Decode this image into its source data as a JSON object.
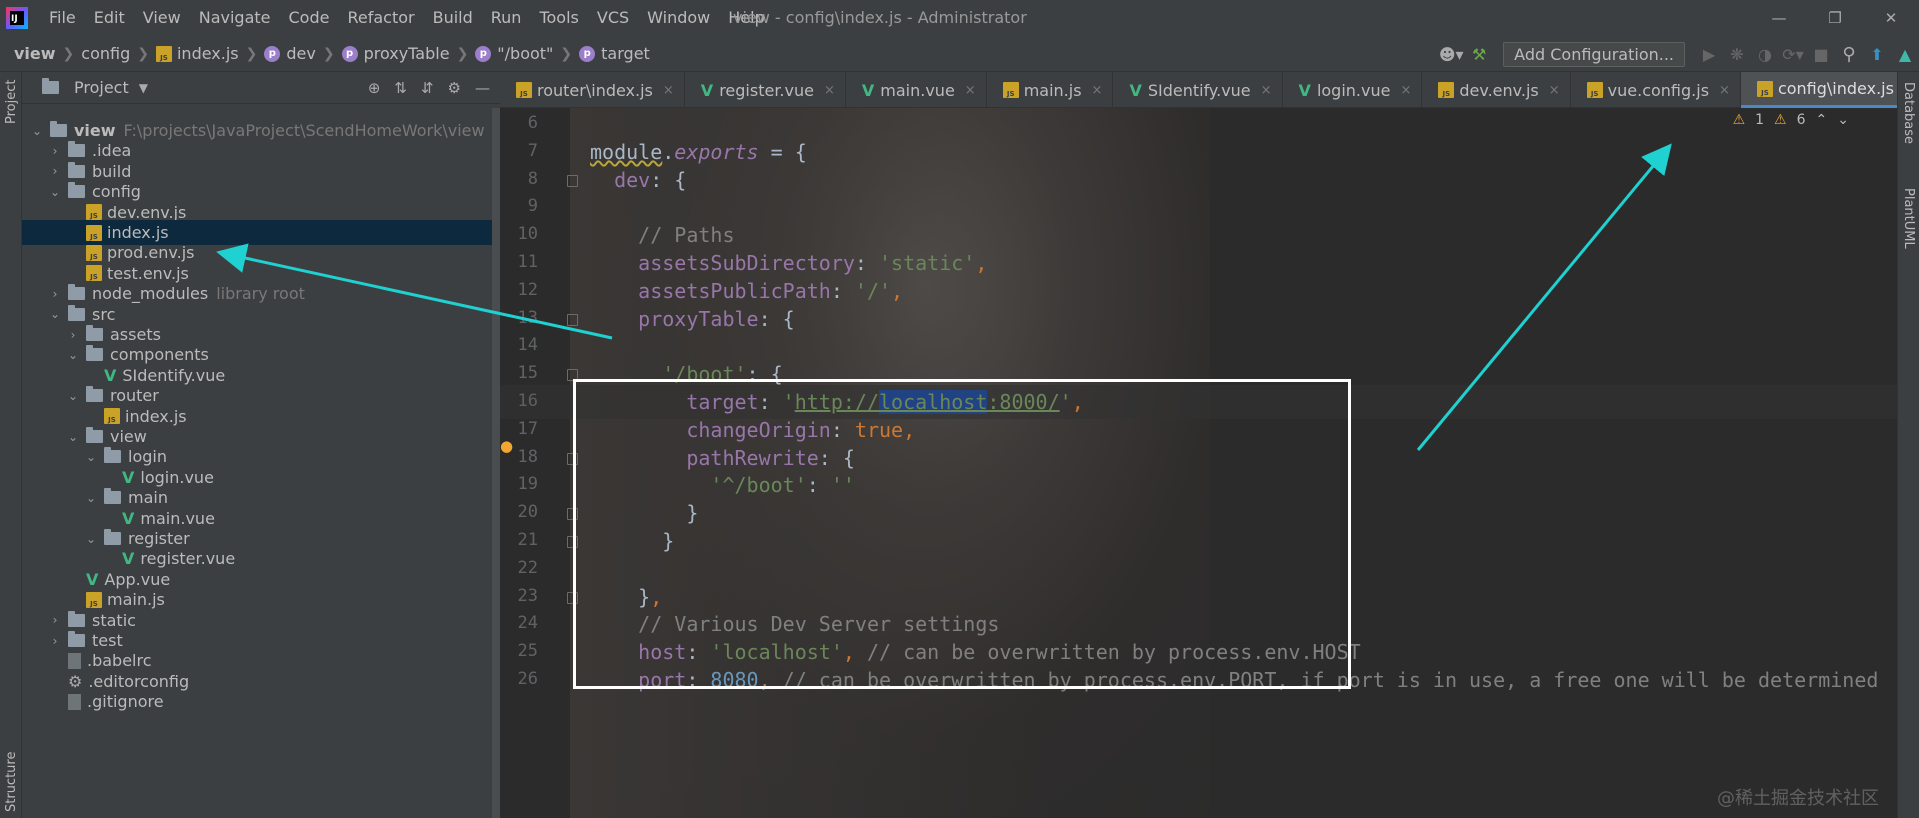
{
  "app": {
    "menu": [
      "File",
      "Edit",
      "View",
      "Navigate",
      "Code",
      "Refactor",
      "Build",
      "Run",
      "Tools",
      "VCS",
      "Window",
      "Help"
    ],
    "window_title": "view - config\\index.js - Administrator"
  },
  "breadcrumb": {
    "project": "view",
    "folder": "config",
    "file": "index.js",
    "prop1": "dev",
    "prop2": "proxyTable",
    "prop3": "\"/boot\"",
    "prop4": "target"
  },
  "toolbar": {
    "add_configuration": "Add Configuration..."
  },
  "project_panel": {
    "title": "Project",
    "strip_label": "Project",
    "structure_label": "Structure",
    "items": [
      {
        "label": "view",
        "hint": "F:\\projects\\JavaProject\\ScendHomeWork\\view",
        "depth": 0,
        "kind": "folder",
        "expanded": true
      },
      {
        "label": ".idea",
        "depth": 1,
        "kind": "folder",
        "expanded": false
      },
      {
        "label": "build",
        "depth": 1,
        "kind": "folder",
        "expanded": false
      },
      {
        "label": "config",
        "depth": 1,
        "kind": "folder",
        "expanded": true
      },
      {
        "label": "dev.env.js",
        "depth": 2,
        "kind": "js"
      },
      {
        "label": "index.js",
        "depth": 2,
        "kind": "js",
        "selected": true
      },
      {
        "label": "prod.env.js",
        "depth": 2,
        "kind": "js"
      },
      {
        "label": "test.env.js",
        "depth": 2,
        "kind": "js"
      },
      {
        "label": "node_modules",
        "hint": "library root",
        "depth": 1,
        "kind": "folder",
        "expanded": false
      },
      {
        "label": "src",
        "depth": 1,
        "kind": "folder",
        "expanded": true
      },
      {
        "label": "assets",
        "depth": 2,
        "kind": "folder",
        "expanded": false
      },
      {
        "label": "components",
        "depth": 2,
        "kind": "folder",
        "expanded": true
      },
      {
        "label": "SIdentify.vue",
        "depth": 3,
        "kind": "vue"
      },
      {
        "label": "router",
        "depth": 2,
        "kind": "folder",
        "expanded": true
      },
      {
        "label": "index.js",
        "depth": 3,
        "kind": "js"
      },
      {
        "label": "view",
        "depth": 2,
        "kind": "folder",
        "expanded": true
      },
      {
        "label": "login",
        "depth": 3,
        "kind": "folder",
        "expanded": true
      },
      {
        "label": "login.vue",
        "depth": 4,
        "kind": "vue"
      },
      {
        "label": "main",
        "depth": 3,
        "kind": "folder",
        "expanded": true
      },
      {
        "label": "main.vue",
        "depth": 4,
        "kind": "vue"
      },
      {
        "label": "register",
        "depth": 3,
        "kind": "folder",
        "expanded": true
      },
      {
        "label": "register.vue",
        "depth": 4,
        "kind": "vue"
      },
      {
        "label": "App.vue",
        "depth": 2,
        "kind": "vue"
      },
      {
        "label": "main.js",
        "depth": 2,
        "kind": "js"
      },
      {
        "label": "static",
        "depth": 1,
        "kind": "folder",
        "expanded": false
      },
      {
        "label": "test",
        "depth": 1,
        "kind": "folder",
        "expanded": false
      },
      {
        "label": ".babelrc",
        "depth": 1,
        "kind": "file"
      },
      {
        "label": ".editorconfig",
        "depth": 1,
        "kind": "gear"
      },
      {
        "label": ".gitignore",
        "depth": 1,
        "kind": "file"
      }
    ]
  },
  "tabs": [
    {
      "label": "router\\index.js",
      "kind": "js"
    },
    {
      "label": "register.vue",
      "kind": "vue"
    },
    {
      "label": "main.vue",
      "kind": "vue"
    },
    {
      "label": "main.js",
      "kind": "js"
    },
    {
      "label": "SIdentify.vue",
      "kind": "vue"
    },
    {
      "label": "login.vue",
      "kind": "vue"
    },
    {
      "label": "dev.env.js",
      "kind": "js"
    },
    {
      "label": "vue.config.js",
      "kind": "js"
    },
    {
      "label": "config\\index.js",
      "kind": "js",
      "active": true
    }
  ],
  "inspections": {
    "warnings": "1",
    "weak_warnings": "6"
  },
  "right_strip": {
    "database": "Database",
    "plantuml": "PlantUML"
  },
  "editor": {
    "current_line": 16,
    "lines": [
      {
        "no": 6,
        "tokens": []
      },
      {
        "no": 7,
        "tokens": [
          {
            "t": "module",
            "c": "squig"
          },
          {
            "t": ".",
            "c": ""
          },
          {
            "t": "exports",
            "c": "ital"
          },
          {
            "t": " = {",
            "c": ""
          }
        ]
      },
      {
        "no": 8,
        "tokens": [
          {
            "t": "  dev",
            "c": "p"
          },
          {
            "t": ": {",
            "c": ""
          }
        ]
      },
      {
        "no": 9,
        "tokens": []
      },
      {
        "no": 10,
        "tokens": [
          {
            "t": "    // Paths",
            "c": "c"
          }
        ]
      },
      {
        "no": 11,
        "tokens": [
          {
            "t": "    assetsSubDirectory",
            "c": "p"
          },
          {
            "t": ": ",
            "c": ""
          },
          {
            "t": "'static'",
            "c": "s"
          },
          {
            "t": ",",
            "c": "k"
          }
        ]
      },
      {
        "no": 12,
        "tokens": [
          {
            "t": "    assetsPublicPath",
            "c": "p"
          },
          {
            "t": ": ",
            "c": ""
          },
          {
            "t": "'/'",
            "c": "s"
          },
          {
            "t": ",",
            "c": "k"
          }
        ]
      },
      {
        "no": 13,
        "tokens": [
          {
            "t": "    proxyTable",
            "c": "p"
          },
          {
            "t": ": {",
            "c": ""
          }
        ]
      },
      {
        "no": 14,
        "tokens": []
      },
      {
        "no": 15,
        "tokens": [
          {
            "t": "      '/boot'",
            "c": "s"
          },
          {
            "t": ": {",
            "c": ""
          }
        ]
      },
      {
        "no": 16,
        "tokens": [
          {
            "t": "        target",
            "c": "p"
          },
          {
            "t": ": ",
            "c": ""
          },
          {
            "t": "'",
            "c": "s"
          },
          {
            "t": "http://",
            "c": "url"
          },
          {
            "t": "localhost",
            "c": "url sel"
          },
          {
            "t": ":8000/",
            "c": "url"
          },
          {
            "t": "'",
            "c": "s"
          },
          {
            "t": ",",
            "c": "k"
          }
        ]
      },
      {
        "no": 17,
        "tokens": [
          {
            "t": "        changeOrigin",
            "c": "p"
          },
          {
            "t": ": ",
            "c": ""
          },
          {
            "t": "true",
            "c": "k"
          },
          {
            "t": ",",
            "c": "k"
          }
        ]
      },
      {
        "no": 18,
        "tokens": [
          {
            "t": "        pathRewrite",
            "c": "p"
          },
          {
            "t": ": {",
            "c": ""
          }
        ]
      },
      {
        "no": 19,
        "tokens": [
          {
            "t": "          '^/boot'",
            "c": "s"
          },
          {
            "t": ": ",
            "c": ""
          },
          {
            "t": "''",
            "c": "s"
          }
        ]
      },
      {
        "no": 20,
        "tokens": [
          {
            "t": "        }",
            "c": ""
          }
        ]
      },
      {
        "no": 21,
        "tokens": [
          {
            "t": "      }",
            "c": ""
          }
        ]
      },
      {
        "no": 22,
        "tokens": []
      },
      {
        "no": 23,
        "tokens": [
          {
            "t": "    }",
            "c": ""
          },
          {
            "t": ",",
            "c": "k"
          }
        ]
      },
      {
        "no": 24,
        "tokens": [
          {
            "t": "    // Various Dev Server settings",
            "c": "c"
          }
        ]
      },
      {
        "no": 25,
        "tokens": [
          {
            "t": "    host",
            "c": "p"
          },
          {
            "t": ": ",
            "c": ""
          },
          {
            "t": "'localhost'",
            "c": "s"
          },
          {
            "t": ",",
            "c": "k"
          },
          {
            "t": " // can be overwritten by process.env.HOST",
            "c": "c"
          }
        ]
      },
      {
        "no": 26,
        "tokens": [
          {
            "t": "    port",
            "c": "p"
          },
          {
            "t": ": ",
            "c": ""
          },
          {
            "t": "8080",
            "c": "n"
          },
          {
            "t": ",",
            "c": "k"
          },
          {
            "t": " // can be overwritten by process.env.PORT, if port is in use, a free one will be determined",
            "c": "c"
          }
        ]
      }
    ]
  },
  "watermark": "@稀土掘金技术社区"
}
